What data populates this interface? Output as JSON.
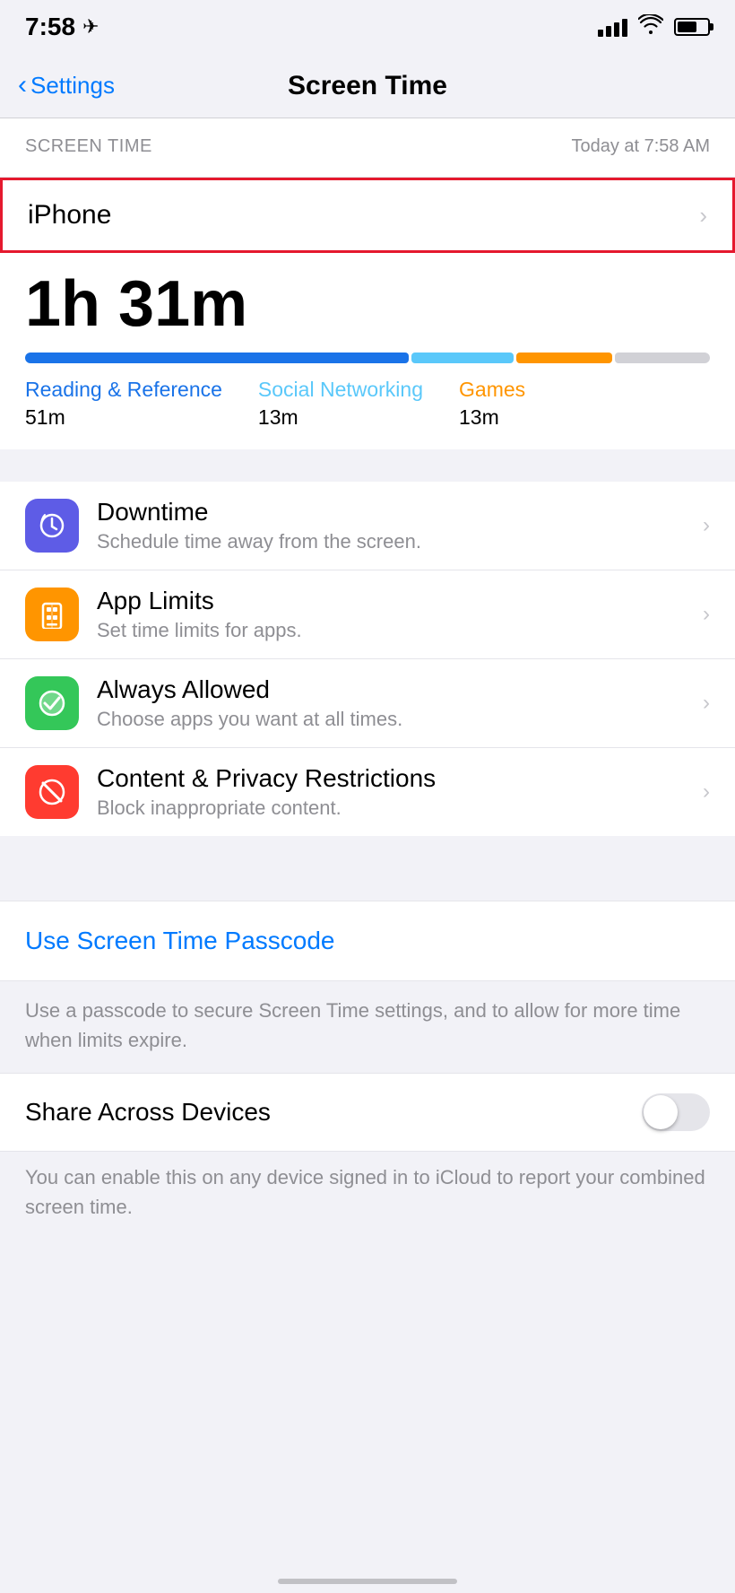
{
  "statusBar": {
    "time": "7:58",
    "locationIcon": "›",
    "batteryPercent": 65
  },
  "navBar": {
    "backLabel": "Settings",
    "title": "Screen Time"
  },
  "screenTime": {
    "sectionLabel": "SCREEN TIME",
    "dateLabel": "Today at 7:58 AM",
    "deviceName": "iPhone",
    "totalTime": "1h 31m",
    "categories": [
      {
        "name": "Reading & Reference",
        "time": "51m",
        "colorClass": "blue",
        "widthPct": 56
      },
      {
        "name": "Social Networking",
        "time": "13m",
        "colorClass": "lightblue",
        "widthPct": 15
      },
      {
        "name": "Games",
        "time": "13m",
        "colorClass": "orange",
        "widthPct": 15
      }
    ]
  },
  "menuItems": [
    {
      "id": "downtime",
      "iconColor": "purple",
      "iconSymbol": "🌙",
      "title": "Downtime",
      "subtitle": "Schedule time away from the screen."
    },
    {
      "id": "app-limits",
      "iconColor": "orange",
      "iconSymbol": "⏳",
      "title": "App Limits",
      "subtitle": "Set time limits for apps."
    },
    {
      "id": "always-allowed",
      "iconColor": "green",
      "iconSymbol": "✅",
      "title": "Always Allowed",
      "subtitle": "Choose apps you want at all times."
    },
    {
      "id": "content-privacy",
      "iconColor": "red",
      "iconSymbol": "🚫",
      "title": "Content & Privacy Restrictions",
      "subtitle": "Block inappropriate content."
    }
  ],
  "passcode": {
    "linkLabel": "Use Screen Time Passcode",
    "description": "Use a passcode to secure Screen Time settings, and to allow for more time when limits expire."
  },
  "shareDevices": {
    "label": "Share Across Devices",
    "description": "You can enable this on any device signed in to iCloud to report your combined screen time.",
    "enabled": false
  }
}
